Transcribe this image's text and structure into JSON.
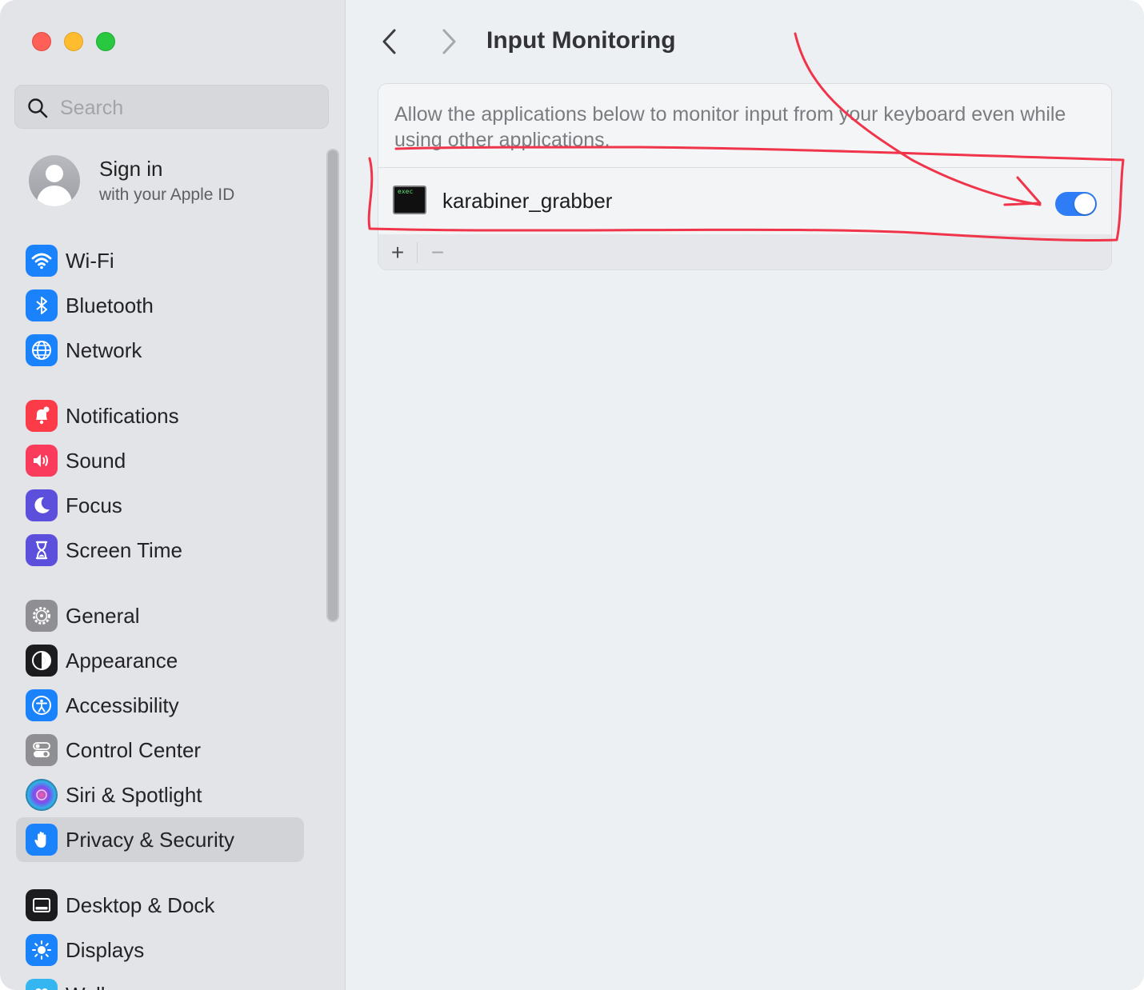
{
  "sidebar": {
    "search": {
      "placeholder": "Search",
      "value": ""
    },
    "account": {
      "title": "Sign in",
      "subtitle": "with your Apple ID"
    },
    "items": [
      {
        "label": "Wi-Fi",
        "icon": "wifi-icon",
        "color": "#1a82fb"
      },
      {
        "label": "Bluetooth",
        "icon": "bluetooth-icon",
        "color": "#1a82fb"
      },
      {
        "label": "Network",
        "icon": "globe-icon",
        "color": "#1a82fb"
      },
      {
        "label": "Notifications",
        "icon": "bell-icon",
        "color": "#fb3b47"
      },
      {
        "label": "Sound",
        "icon": "speaker-icon",
        "color": "#fb3b5c"
      },
      {
        "label": "Focus",
        "icon": "moon-icon",
        "color": "#5c4fdc"
      },
      {
        "label": "Screen Time",
        "icon": "hourglass-icon",
        "color": "#5c4fdc"
      },
      {
        "label": "General",
        "icon": "gear-icon",
        "color": "#8e8e93"
      },
      {
        "label": "Appearance",
        "icon": "appearance-icon",
        "color": "#1c1c1e"
      },
      {
        "label": "Accessibility",
        "icon": "accessibility-icon",
        "color": "#1a82fb"
      },
      {
        "label": "Control Center",
        "icon": "toggles-icon",
        "color": "#8e8e93"
      },
      {
        "label": "Siri & Spotlight",
        "icon": "siri-icon",
        "color": "#2a1f4f"
      },
      {
        "label": "Privacy & Security",
        "icon": "hand-icon",
        "color": "#1a82fb",
        "selected": true
      },
      {
        "label": "Desktop & Dock",
        "icon": "dock-icon",
        "color": "#1c1c1e"
      },
      {
        "label": "Displays",
        "icon": "sun-icon",
        "color": "#1a82fb"
      },
      {
        "label": "Wallpaper",
        "icon": "wallpaper-icon",
        "color": "#35b6f0"
      }
    ]
  },
  "main": {
    "title": "Input Monitoring",
    "description": "Allow the applications below to monitor input from your keyboard even while using other applications.",
    "apps": [
      {
        "name": "karabiner_grabber",
        "icon": "exec-icon",
        "icon_text": "exec",
        "enabled": true
      }
    ],
    "footer": {
      "add_label": "+",
      "remove_label": "−"
    }
  },
  "colors": {
    "accent": "#2e7df6",
    "annotation": "#f0354b"
  }
}
